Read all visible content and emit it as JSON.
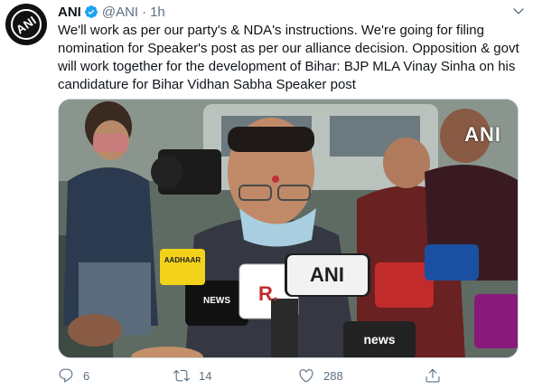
{
  "tweet": {
    "author_name": "ANI",
    "author_handle": "@ANI",
    "separator": "·",
    "time": "1h",
    "avatar_text": "ANI",
    "text": "We'll work as per our party's & NDA's instructions. We're going for filing nomination for Speaker's post as per our alliance decision. Opposition & govt will work together for the development of Bihar: BJP MLA Vinay Sinha on his candidature for Bihar Vidhan Sabha Speaker post",
    "media": {
      "watermark": "ANI",
      "mic_labels": {
        "ani": "ANI",
        "r": "R.",
        "news": "NEWS",
        "aadhaar": "AADHAAR",
        "news2": "news"
      }
    },
    "actions": {
      "reply_count": "6",
      "retweet_count": "14",
      "like_count": "288"
    }
  },
  "icons": {
    "verified": "verified-badge-icon",
    "more": "chevron-down-icon",
    "reply": "reply-icon",
    "retweet": "retweet-icon",
    "like": "heart-icon",
    "share": "share-icon"
  },
  "colors": {
    "verified": "#1da1f2",
    "secondary_text": "#5b7083",
    "primary_text": "#0f1419"
  }
}
